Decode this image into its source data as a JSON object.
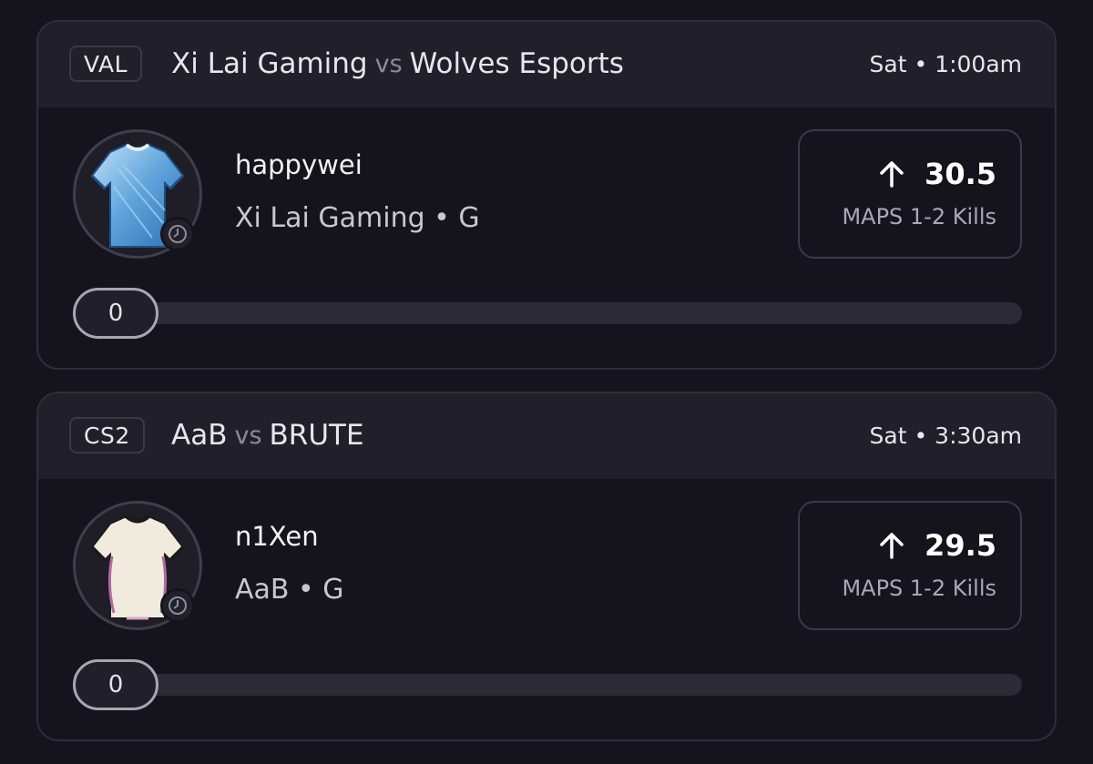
{
  "cards": [
    {
      "league": "VAL",
      "team_a": "Xi Lai Gaming",
      "vs": "vs",
      "team_b": "Wolves Esports",
      "time": "Sat • 1:00am",
      "player": {
        "name": "happywei",
        "team_pos": "Xi Lai Gaming • G",
        "jersey_icon": "jersey-icon",
        "jersey_color": "#4f8fd0"
      },
      "line": {
        "direction_icon": "arrow-up-icon",
        "value": "30.5",
        "stat": "MAPS 1-2 Kills"
      },
      "progress": {
        "value": "0",
        "fraction": 0
      }
    },
    {
      "league": "CS2",
      "team_a": "AaB",
      "vs": "vs",
      "team_b": "BRUTE",
      "time": "Sat • 3:30am",
      "player": {
        "name": "n1Xen",
        "team_pos": "AaB • G",
        "jersey_icon": "jersey-icon",
        "jersey_color": "#efe9dc"
      },
      "line": {
        "direction_icon": "arrow-up-icon",
        "value": "29.5",
        "stat": "MAPS 1-2 Kills"
      },
      "progress": {
        "value": "0",
        "fraction": 0
      }
    }
  ],
  "colors": {
    "background": "#15141d",
    "header": "#201f2a",
    "border": "#2e2d38",
    "track": "#2b2a35"
  }
}
